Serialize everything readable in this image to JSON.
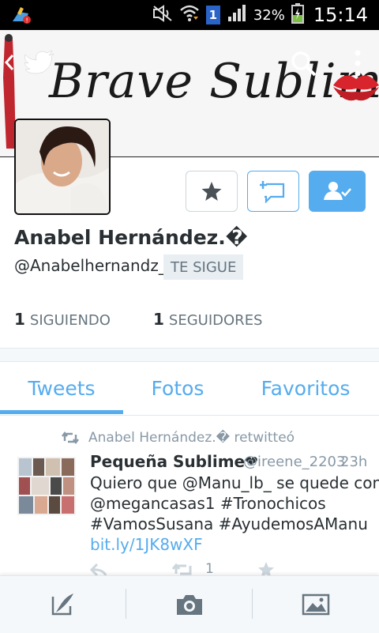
{
  "status_bar": {
    "sim": "1",
    "battery_pct": "32%",
    "time": "15:14"
  },
  "banner": {
    "title": "Brave Sublime"
  },
  "profile": {
    "name": "Anabel Hernández.�",
    "handle": "@Anabelhernandz_",
    "follows_you": "TE SIGUE",
    "following_count": "1",
    "following_label": "SIGUIENDO",
    "followers_count": "1",
    "followers_label": "SEGUIDORES"
  },
  "tabs": [
    {
      "label": "Tweets",
      "active": true
    },
    {
      "label": "Fotos",
      "active": false
    },
    {
      "label": "Favoritos",
      "active": false
    }
  ],
  "tweet": {
    "retweeted_by": "Anabel Hernández.� retwitteó",
    "author": "Pequeña Sublime❤",
    "handle": "@ireene_2203",
    "time": "23h",
    "lines": [
      "Quiero que @Manu_lb_ se quede con",
      "@megancasas1 #Tronochicos",
      "#VamosSusana #AyudemosAManu"
    ],
    "link": "bit.ly/1JK8wXF",
    "retweet_count": "1"
  },
  "colors": {
    "accent": "#55acee",
    "muted": "#8899a6",
    "text": "#292f33"
  },
  "icons": {
    "compose": "compose-icon",
    "camera": "camera-icon",
    "gallery": "gallery-icon"
  }
}
